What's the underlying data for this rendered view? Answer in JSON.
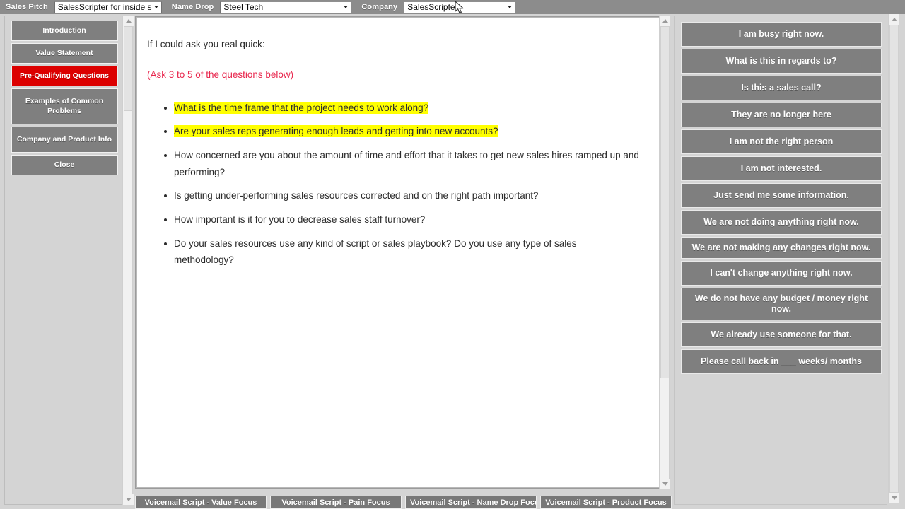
{
  "topbar": {
    "pitch_label": "Sales Pitch",
    "pitch_value": "SalesScripter for inside s",
    "namedrop_label": "Name Drop",
    "namedrop_value": "Steel Tech",
    "company_label": "Company",
    "company_value": "SalesScripter",
    "bar_color": "#8c8c8c"
  },
  "sidebar": {
    "items": [
      {
        "label": "Introduction",
        "active": false
      },
      {
        "label": "Value Statement",
        "active": false
      },
      {
        "label": "Pre-Qualifying Questions",
        "active": true
      },
      {
        "label": "Examples of Common Problems",
        "active": false
      },
      {
        "label": "Company and Product Info",
        "active": false
      },
      {
        "label": "Close",
        "active": false
      }
    ],
    "active_color": "#dc0000",
    "button_color": "#7f7f7f"
  },
  "script": {
    "lead": "If I could ask you real quick:",
    "note": "(Ask 3 to 5 of the questions below)",
    "note_color": "#e8264d",
    "highlight_color": "#ffff00",
    "questions": [
      {
        "text": "What is the time frame that the project needs to work along?",
        "highlighted": true
      },
      {
        "text": "Are your sales reps generating enough leads and getting into new accounts?",
        "highlighted": true
      },
      {
        "text": "How concerned are you about the amount of time and effort that it takes to get new sales hires ramped up and performing?",
        "highlighted": false
      },
      {
        "text": "Is getting under-performing sales resources corrected and on the right path important?",
        "highlighted": false
      },
      {
        "text": "How important is it for you to decrease sales staff turnover?",
        "highlighted": false
      },
      {
        "text": "Do your sales resources use any kind of script or sales playbook? Do you use any type of sales methodology?",
        "highlighted": false
      }
    ]
  },
  "objections": {
    "items": [
      "I am busy right now.",
      "What is this in regards to?",
      "Is this a sales call?",
      "They are no longer here",
      "I am not the right person",
      "I am not interested.",
      "Just send me some information.",
      "We are not doing anything right now.",
      "We are not making any changes right now.",
      "I can't change anything right now.",
      "We do not have any budget / money right now.",
      "We already use someone for that.",
      "Please call back in ___ weeks/ months"
    ]
  },
  "voicemail_tabs": [
    "Voicemail Script - Value Focus",
    "Voicemail Script - Pain Focus",
    "Voicemail Script - Name Drop Focus",
    "Voicemail Script - Product Focus"
  ]
}
